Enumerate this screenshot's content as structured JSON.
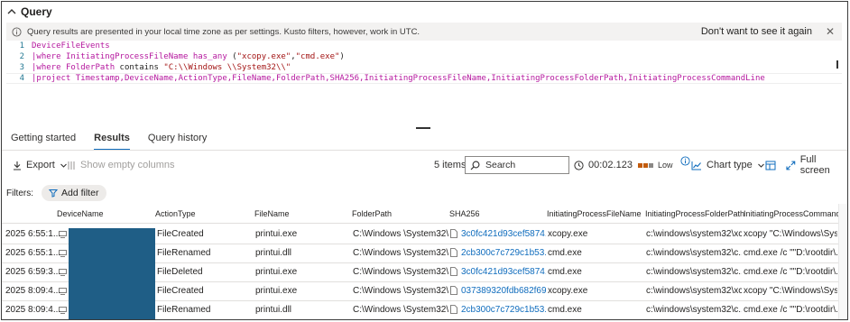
{
  "header": {
    "title": "Query"
  },
  "notice": {
    "text": "Query results are presented in your local time zone as per settings. Kusto filters, however, work in UTC.",
    "dismiss_label": "Don't want to see it again",
    "close_glyph": "✕"
  },
  "editor": {
    "lines": [
      {
        "num": "1",
        "tokens": [
          {
            "t": "DeviceFileEvents",
            "c": "kw"
          }
        ]
      },
      {
        "num": "2",
        "tokens": [
          {
            "t": "|",
            "c": "kw"
          },
          {
            "t": "where ",
            "c": "kw"
          },
          {
            "t": "InitiatingProcessFileName ",
            "c": "kw"
          },
          {
            "t": "has_any ",
            "c": "kw"
          },
          {
            "t": "(",
            "c": "plain"
          },
          {
            "t": "\"xcopy.exe\"",
            "c": "str"
          },
          {
            "t": ",",
            "c": "plain"
          },
          {
            "t": "\"cmd.exe\"",
            "c": "str"
          },
          {
            "t": ")",
            "c": "plain"
          }
        ]
      },
      {
        "num": "3",
        "tokens": [
          {
            "t": "|",
            "c": "kw"
          },
          {
            "t": "where ",
            "c": "kw"
          },
          {
            "t": "FolderPath ",
            "c": "kw"
          },
          {
            "t": "contains ",
            "c": "plain"
          },
          {
            "t": "\"C:\\\\Windows \\\\System32\\\\\"",
            "c": "str"
          }
        ]
      },
      {
        "num": "4",
        "tokens": [
          {
            "t": "|",
            "c": "kw"
          },
          {
            "t": "project ",
            "c": "kw"
          },
          {
            "t": "Timestamp,DeviceName,ActionType,FileName,FolderPath,SHA256,InitiatingProcessFileName,InitiatingProcessFolderPath,InitiatingProcessCommandLine",
            "c": "kw"
          }
        ]
      }
    ]
  },
  "tabs": [
    {
      "label": "Getting started",
      "active": false
    },
    {
      "label": "Results",
      "active": true
    },
    {
      "label": "Query history",
      "active": false
    }
  ],
  "toolbar": {
    "export_label": "Export",
    "show_empty_label": "Show empty columns",
    "items_count": "5 items",
    "search_placeholder": "Search",
    "elapsed": "00:02.123",
    "usage_level": "Low",
    "chart_type_label": "Chart type",
    "full_screen_label": "Full screen"
  },
  "filters": {
    "label": "Filters:",
    "add_label": "Add filter"
  },
  "table": {
    "columns": [
      "",
      "DeviceName",
      "ActionType",
      "FileName",
      "FolderPath",
      "SHA256",
      "InitiatingProcessFileName",
      "InitiatingProcessFolderPath",
      "InitiatingProcessCommandLi..."
    ],
    "rows": [
      {
        "ts": "2025 6:55:1...",
        "action": "FileCreated",
        "file": "printui.exe",
        "folder": "C:\\Windows \\System32\\...",
        "sha": "3c0fc421d93cef5874...",
        "ipfile": "xcopy.exe",
        "ipfolder": "c:\\windows\\system32\\xc...",
        "cmd": "xcopy \"C:\\Windows\\Syst..."
      },
      {
        "ts": "2025 6:55:1...",
        "action": "FileRenamed",
        "file": "printui.dll",
        "folder": "C:\\Windows \\System32\\...",
        "sha": "2cb300c7c729c1b53...",
        "ipfile": "cmd.exe",
        "ipfolder": "c:\\windows\\system32\\c...",
        "cmd": "cmd.exe /c \"\"D:\\rootdir\\..."
      },
      {
        "ts": "2025 6:59:3...",
        "action": "FileDeleted",
        "file": "printui.exe",
        "folder": "C:\\Windows \\System32\\...",
        "sha": "3c0fc421d93cef5874...",
        "ipfile": "cmd.exe",
        "ipfolder": "c:\\windows\\system32\\c...",
        "cmd": "cmd.exe /c \"\"D:\\rootdir\\..."
      },
      {
        "ts": "2025 8:09:4...",
        "action": "FileCreated",
        "file": "printui.exe",
        "folder": "C:\\Windows \\System32\\...",
        "sha": "037389320fdb682f69...",
        "ipfile": "xcopy.exe",
        "ipfolder": "c:\\windows\\system32\\xc...",
        "cmd": "xcopy \"C:\\Windows\\Syst..."
      },
      {
        "ts": "2025 8:09:4...",
        "action": "FileRenamed",
        "file": "printui.dll",
        "folder": "C:\\Windows \\System32\\...",
        "sha": "2cb300c7c729c1b53...",
        "ipfile": "cmd.exe",
        "ipfolder": "c:\\windows\\system32\\c...",
        "cmd": "cmd.exe /c \"\"D:\\rootdir\\..."
      }
    ]
  },
  "colors": {
    "accent": "#0f6cbd",
    "keyword": "#b5179e",
    "string": "#a31515",
    "redaction": "#1f5e86",
    "usage": "#c25b0c"
  }
}
